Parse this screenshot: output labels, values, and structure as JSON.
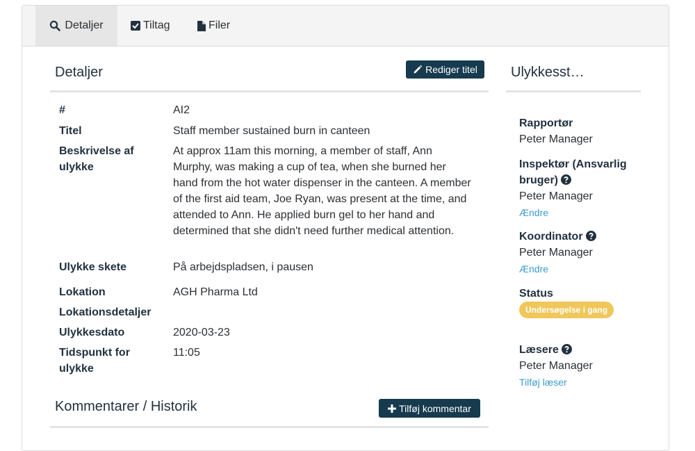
{
  "tabs": [
    {
      "label": "Detaljer",
      "icon": "search-icon",
      "active": true
    },
    {
      "label": "Tiltag",
      "icon": "checkbox-icon",
      "active": false
    },
    {
      "label": "Filer",
      "icon": "file-icon",
      "active": false
    }
  ],
  "details": {
    "title": "Detaljer",
    "edit_button": "Rediger titel",
    "fields": [
      {
        "label": "#",
        "value": "AI2"
      },
      {
        "label": "Titel",
        "value": "Staff member sustained burn in canteen"
      },
      {
        "label": "Beskrivelse af ulykke",
        "value": "At approx 11am this morning, a member of staff, Ann Murphy, was making a cup of tea, when she burned her hand from the hot water dispenser in the canteen. A member of the first aid team, Joe Ryan, was present at the time, and attended to Ann. He applied burn gel to her hand and determined that she didn't need further medical attention."
      },
      {
        "label": "Ulykke skete",
        "value": "På arbejdspladsen, i pausen"
      },
      {
        "label": "Lokation",
        "value": "AGH Pharma Ltd"
      },
      {
        "label": "Lokationsdetaljer",
        "value": ""
      },
      {
        "label": "Ulykkesdato",
        "value": "2020-03-23"
      },
      {
        "label": "Tidspunkt for ulykke",
        "value": "11:05"
      }
    ]
  },
  "comments": {
    "title": "Kommentarer / Historik",
    "add_button": "Tilføj kommentar"
  },
  "sidebar": {
    "title": "Ulykkesst…",
    "reporter_label": "Rapportør",
    "reporter_value": "Peter Manager",
    "inspector_label": "Inspektør (Ansvarlig bruger)",
    "inspector_value": "Peter Manager",
    "inspector_change": "Ændre",
    "coordinator_label": "Koordinator",
    "coordinator_value": "Peter Manager",
    "coordinator_change": "Ændre",
    "status_label": "Status",
    "status_badge": "Undersøgelse i gang",
    "readers_label": "Læsere",
    "readers_value": "Peter Manager",
    "add_reader": "Tilføj læser"
  },
  "colors": {
    "button_bg": "#163a4e",
    "link": "#3b9bd1",
    "badge": "#f0c75a"
  }
}
